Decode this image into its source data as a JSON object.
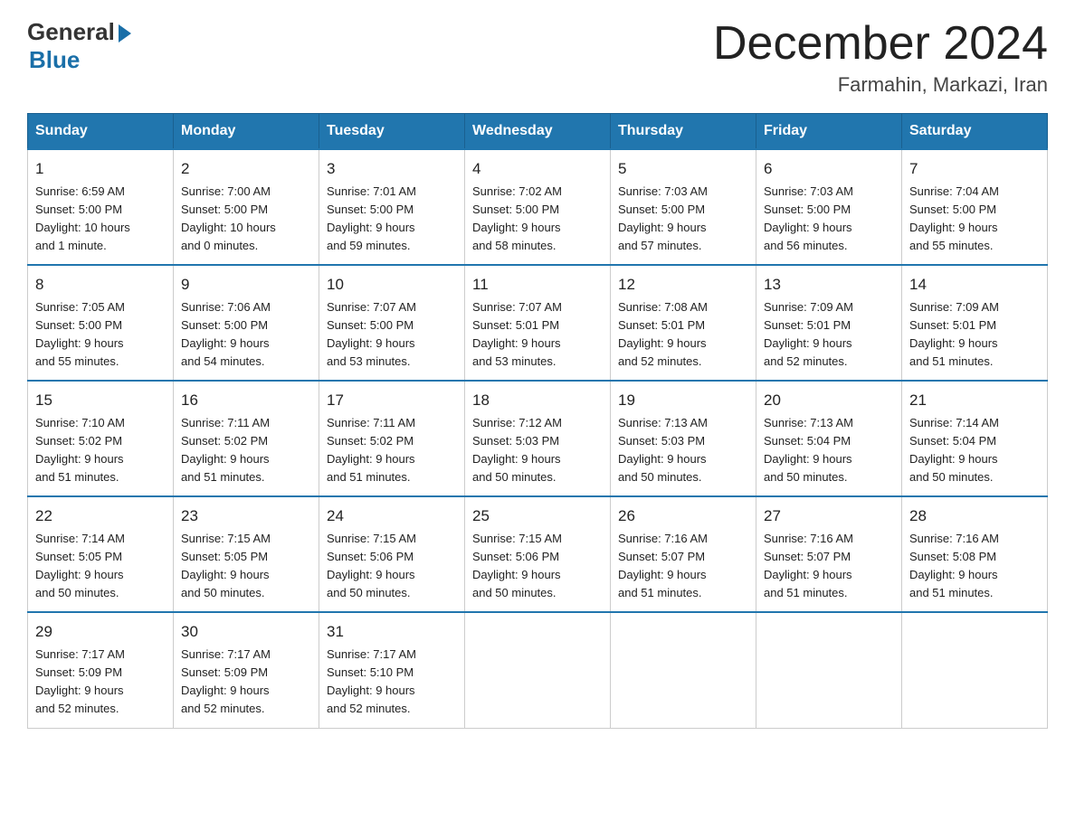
{
  "header": {
    "logo_general": "General",
    "logo_blue": "Blue",
    "month": "December 2024",
    "location": "Farmahin, Markazi, Iran"
  },
  "days_of_week": [
    "Sunday",
    "Monday",
    "Tuesday",
    "Wednesday",
    "Thursday",
    "Friday",
    "Saturday"
  ],
  "weeks": [
    [
      {
        "day": "1",
        "sunrise": "6:59 AM",
        "sunset": "5:00 PM",
        "daylight": "10 hours and 1 minute."
      },
      {
        "day": "2",
        "sunrise": "7:00 AM",
        "sunset": "5:00 PM",
        "daylight": "10 hours and 0 minutes."
      },
      {
        "day": "3",
        "sunrise": "7:01 AM",
        "sunset": "5:00 PM",
        "daylight": "9 hours and 59 minutes."
      },
      {
        "day": "4",
        "sunrise": "7:02 AM",
        "sunset": "5:00 PM",
        "daylight": "9 hours and 58 minutes."
      },
      {
        "day": "5",
        "sunrise": "7:03 AM",
        "sunset": "5:00 PM",
        "daylight": "9 hours and 57 minutes."
      },
      {
        "day": "6",
        "sunrise": "7:03 AM",
        "sunset": "5:00 PM",
        "daylight": "9 hours and 56 minutes."
      },
      {
        "day": "7",
        "sunrise": "7:04 AM",
        "sunset": "5:00 PM",
        "daylight": "9 hours and 55 minutes."
      }
    ],
    [
      {
        "day": "8",
        "sunrise": "7:05 AM",
        "sunset": "5:00 PM",
        "daylight": "9 hours and 55 minutes."
      },
      {
        "day": "9",
        "sunrise": "7:06 AM",
        "sunset": "5:00 PM",
        "daylight": "9 hours and 54 minutes."
      },
      {
        "day": "10",
        "sunrise": "7:07 AM",
        "sunset": "5:00 PM",
        "daylight": "9 hours and 53 minutes."
      },
      {
        "day": "11",
        "sunrise": "7:07 AM",
        "sunset": "5:01 PM",
        "daylight": "9 hours and 53 minutes."
      },
      {
        "day": "12",
        "sunrise": "7:08 AM",
        "sunset": "5:01 PM",
        "daylight": "9 hours and 52 minutes."
      },
      {
        "day": "13",
        "sunrise": "7:09 AM",
        "sunset": "5:01 PM",
        "daylight": "9 hours and 52 minutes."
      },
      {
        "day": "14",
        "sunrise": "7:09 AM",
        "sunset": "5:01 PM",
        "daylight": "9 hours and 51 minutes."
      }
    ],
    [
      {
        "day": "15",
        "sunrise": "7:10 AM",
        "sunset": "5:02 PM",
        "daylight": "9 hours and 51 minutes."
      },
      {
        "day": "16",
        "sunrise": "7:11 AM",
        "sunset": "5:02 PM",
        "daylight": "9 hours and 51 minutes."
      },
      {
        "day": "17",
        "sunrise": "7:11 AM",
        "sunset": "5:02 PM",
        "daylight": "9 hours and 51 minutes."
      },
      {
        "day": "18",
        "sunrise": "7:12 AM",
        "sunset": "5:03 PM",
        "daylight": "9 hours and 50 minutes."
      },
      {
        "day": "19",
        "sunrise": "7:13 AM",
        "sunset": "5:03 PM",
        "daylight": "9 hours and 50 minutes."
      },
      {
        "day": "20",
        "sunrise": "7:13 AM",
        "sunset": "5:04 PM",
        "daylight": "9 hours and 50 minutes."
      },
      {
        "day": "21",
        "sunrise": "7:14 AM",
        "sunset": "5:04 PM",
        "daylight": "9 hours and 50 minutes."
      }
    ],
    [
      {
        "day": "22",
        "sunrise": "7:14 AM",
        "sunset": "5:05 PM",
        "daylight": "9 hours and 50 minutes."
      },
      {
        "day": "23",
        "sunrise": "7:15 AM",
        "sunset": "5:05 PM",
        "daylight": "9 hours and 50 minutes."
      },
      {
        "day": "24",
        "sunrise": "7:15 AM",
        "sunset": "5:06 PM",
        "daylight": "9 hours and 50 minutes."
      },
      {
        "day": "25",
        "sunrise": "7:15 AM",
        "sunset": "5:06 PM",
        "daylight": "9 hours and 50 minutes."
      },
      {
        "day": "26",
        "sunrise": "7:16 AM",
        "sunset": "5:07 PM",
        "daylight": "9 hours and 51 minutes."
      },
      {
        "day": "27",
        "sunrise": "7:16 AM",
        "sunset": "5:07 PM",
        "daylight": "9 hours and 51 minutes."
      },
      {
        "day": "28",
        "sunrise": "7:16 AM",
        "sunset": "5:08 PM",
        "daylight": "9 hours and 51 minutes."
      }
    ],
    [
      {
        "day": "29",
        "sunrise": "7:17 AM",
        "sunset": "5:09 PM",
        "daylight": "9 hours and 52 minutes."
      },
      {
        "day": "30",
        "sunrise": "7:17 AM",
        "sunset": "5:09 PM",
        "daylight": "9 hours and 52 minutes."
      },
      {
        "day": "31",
        "sunrise": "7:17 AM",
        "sunset": "5:10 PM",
        "daylight": "9 hours and 52 minutes."
      },
      null,
      null,
      null,
      null
    ]
  ],
  "labels": {
    "sunrise": "Sunrise:",
    "sunset": "Sunset:",
    "daylight": "Daylight:"
  }
}
